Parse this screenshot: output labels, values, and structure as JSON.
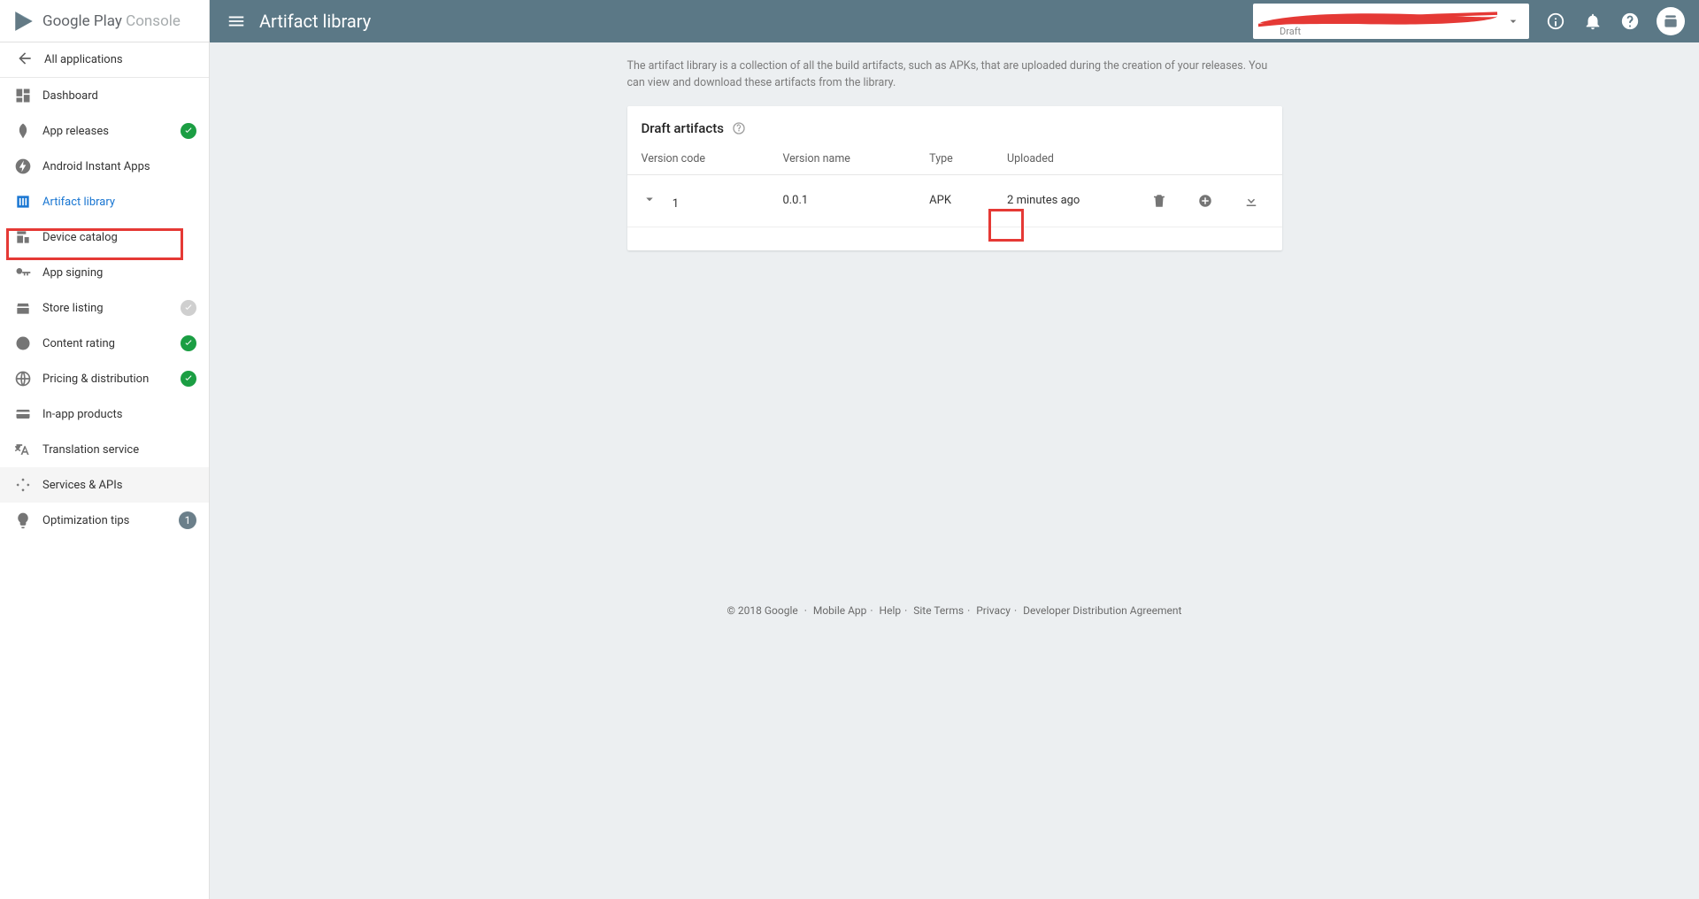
{
  "brand": {
    "google": "Google",
    "play": " Play ",
    "console": "Console"
  },
  "header": {
    "title": "Artifact library",
    "selector_status": "Draft"
  },
  "sidebar": {
    "back_label": "All applications",
    "items": [
      {
        "label": "Dashboard"
      },
      {
        "label": "App releases"
      },
      {
        "label": "Android Instant Apps"
      },
      {
        "label": "Artifact library"
      },
      {
        "label": "Device catalog"
      },
      {
        "label": "App signing"
      },
      {
        "label": "Store listing"
      },
      {
        "label": "Content rating"
      },
      {
        "label": "Pricing & distribution"
      },
      {
        "label": "In-app products"
      },
      {
        "label": "Translation service"
      },
      {
        "label": "Services & APIs"
      },
      {
        "label": "Optimization tips",
        "badge": "1"
      }
    ]
  },
  "main": {
    "description": "The artifact library is a collection of all the build artifacts, such as APKs, that are uploaded during the creation of your releases. You can view and download these artifacts from the library.",
    "section_title": "Draft artifacts",
    "columns": {
      "code": "Version code",
      "name": "Version name",
      "type": "Type",
      "uploaded": "Uploaded"
    },
    "rows": [
      {
        "code": "1",
        "name": "0.0.1",
        "type": "APK",
        "uploaded": "2 minutes ago"
      }
    ]
  },
  "footer": {
    "copyright": "© 2018 Google",
    "links": [
      "Mobile App",
      "Help",
      "Site Terms",
      "Privacy",
      "Developer Distribution Agreement"
    ]
  }
}
